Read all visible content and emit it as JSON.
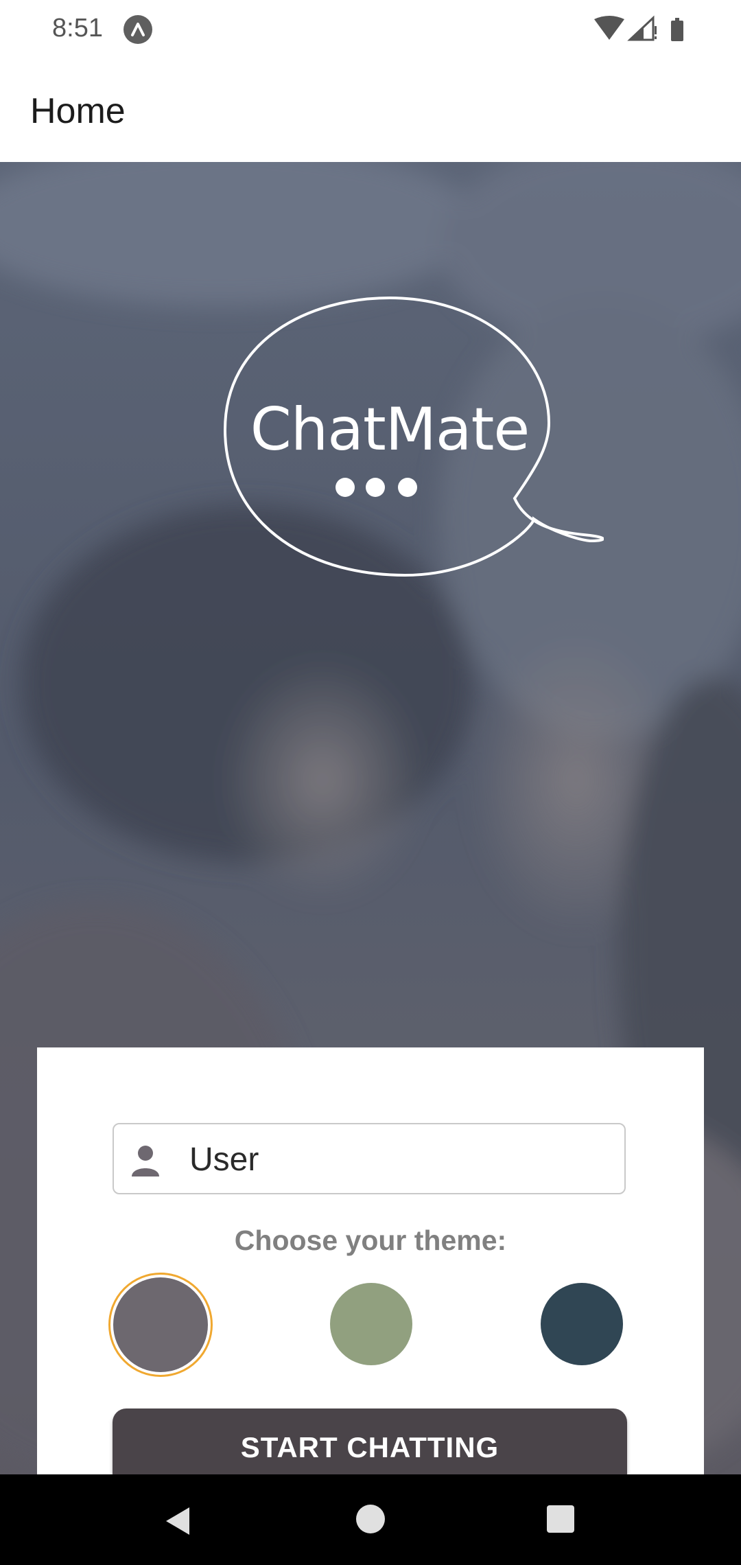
{
  "status_bar": {
    "time": "8:51",
    "icons": [
      "app-notification-icon",
      "wifi-icon",
      "signal-icon",
      "battery-icon"
    ]
  },
  "app_bar": {
    "title": "Home"
  },
  "logo": {
    "text": "ChatMate"
  },
  "form": {
    "name_value": "User",
    "theme_label": "Choose your theme:",
    "themes": [
      {
        "color": "#6d686f",
        "selected": true
      },
      {
        "color": "#91a07f",
        "selected": false
      },
      {
        "color": "#304654",
        "selected": false
      }
    ],
    "selected_ring_color": "#f0a830",
    "start_button_label": "START CHATTING",
    "start_button_color": "#4a4449"
  },
  "nav_bar": {
    "buttons": [
      "back-icon",
      "home-icon",
      "recents-icon"
    ]
  }
}
